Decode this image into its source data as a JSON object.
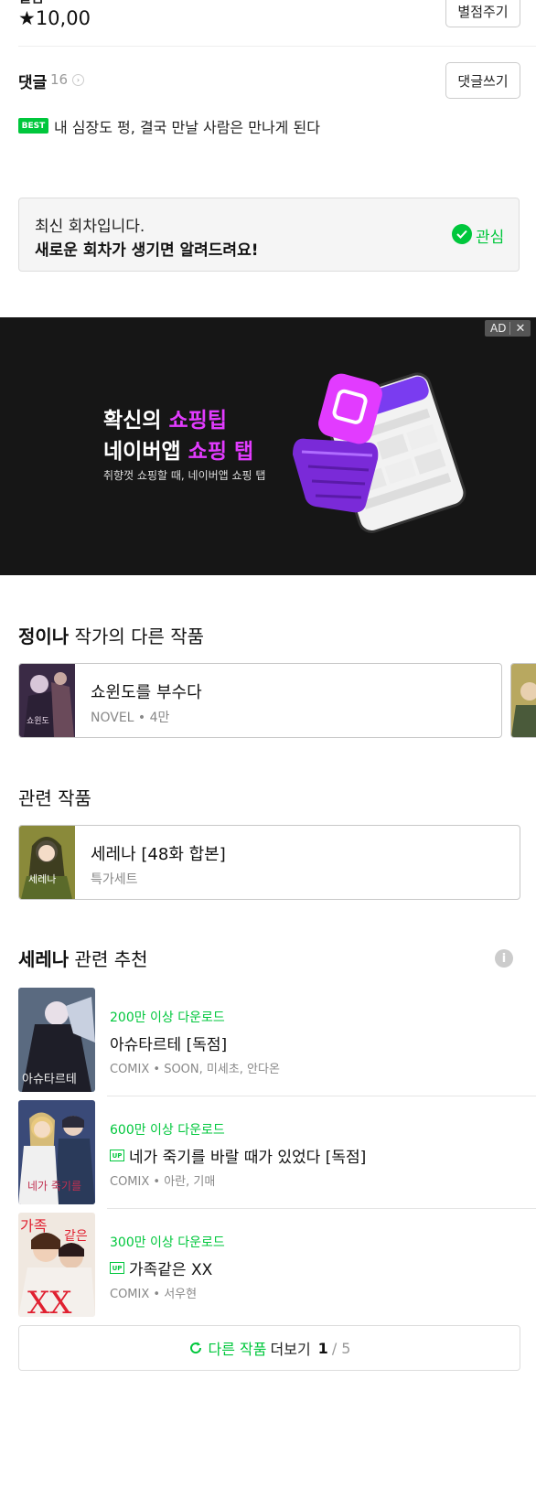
{
  "rating": {
    "label_cut": "별점",
    "value": "★10,00",
    "rate_button": "별점주기"
  },
  "comments": {
    "title": "댓글",
    "count": "16",
    "write_button": "댓글쓰기",
    "best_badge": "BEST",
    "best_text": "내 심장도 펑, 결국 만날 사람은 만나게 된다"
  },
  "notice": {
    "line1": "최신 회차입니다.",
    "line2": "새로운 회차가 생기면 알려드려요!",
    "interest_label": "관심"
  },
  "ad": {
    "badge_ad": "AD",
    "badge_close": "✕",
    "head1_prefix": "확신의 ",
    "head1_pink": "쇼핑팁",
    "head2_prefix": "네이버앱 ",
    "head2_pink": "쇼핑 탭",
    "sub": "취향껏 쇼핑할 때, 네이버앱 쇼핑 탭",
    "accent": "#e23bff"
  },
  "author_works": {
    "author": "정이나",
    "title_suffix": " 작가의 다른 작품",
    "items": [
      {
        "title": "쇼윈도를 부수다",
        "meta": "NOVEL • 4만"
      }
    ]
  },
  "related": {
    "title": "관련 작품",
    "items": [
      {
        "title": "세레나 [48화 합본]",
        "meta": "특가세트"
      }
    ]
  },
  "recommend": {
    "subject": "세레나",
    "title_suffix": " 관련 추천",
    "info_icon": "i",
    "items": [
      {
        "downloads": "200만 이상 다운로드",
        "up": false,
        "title": "아슈타르테 [독점]",
        "meta": "COMIX • SOON, 미세초, 안다온"
      },
      {
        "downloads": "600만 이상 다운로드",
        "up": true,
        "title": "네가 죽기를 바랄 때가 있었다 [독점]",
        "meta": "COMIX • 아란, 기매"
      },
      {
        "downloads": "300만 이상 다운로드",
        "up": true,
        "title": "가족같은 XX",
        "meta": "COMIX • 서우현"
      }
    ],
    "up_badge": "UP"
  },
  "more": {
    "green_label": "다른 작품",
    "dark_label": "더보기",
    "current": "1",
    "total": "/ 5"
  },
  "colors": {
    "green": "#00c73c",
    "ad_bg": "#161616"
  }
}
